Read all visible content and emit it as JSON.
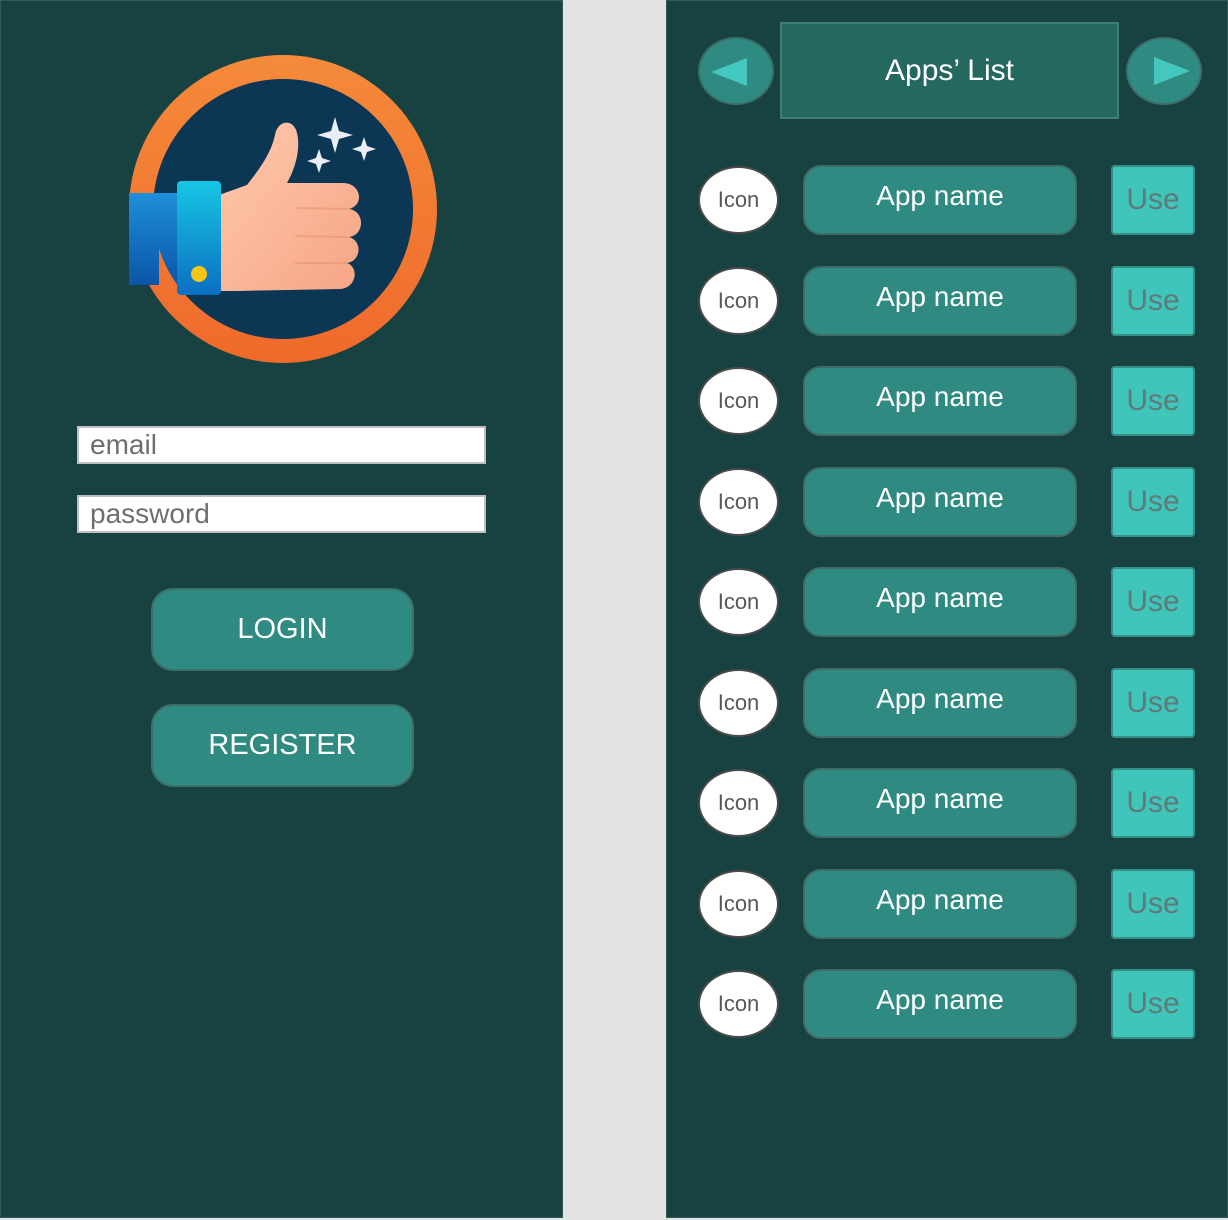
{
  "login": {
    "email_placeholder": "email",
    "password_placeholder": "password",
    "login_label": "LOGIN",
    "register_label": "REGISTER"
  },
  "logo": {
    "icon": "thumbs-up-icon",
    "ring_color": "#f07b33",
    "inner_color": "#0b3654"
  },
  "apps_list": {
    "title": "Apps’ List",
    "prev_icon": "arrow-left-icon",
    "next_icon": "arrow-right-icon",
    "items": [
      {
        "icon_label": "Icon",
        "name": "App name",
        "action": "Use"
      },
      {
        "icon_label": "Icon",
        "name": "App name",
        "action": "Use"
      },
      {
        "icon_label": "Icon",
        "name": "App name",
        "action": "Use"
      },
      {
        "icon_label": "Icon",
        "name": "App name",
        "action": "Use"
      },
      {
        "icon_label": "Icon",
        "name": "App name",
        "action": "Use"
      },
      {
        "icon_label": "Icon",
        "name": "App name",
        "action": "Use"
      },
      {
        "icon_label": "Icon",
        "name": "App name",
        "action": "Use"
      },
      {
        "icon_label": "Icon",
        "name": "App name",
        "action": "Use"
      },
      {
        "icon_label": "Icon",
        "name": "App name",
        "action": "Use"
      }
    ]
  },
  "colors": {
    "panel_bg": "#184241",
    "button_bg": "#2f8b82",
    "use_button_bg": "#40c5bb",
    "divider_bg": "#e3e3e3"
  }
}
